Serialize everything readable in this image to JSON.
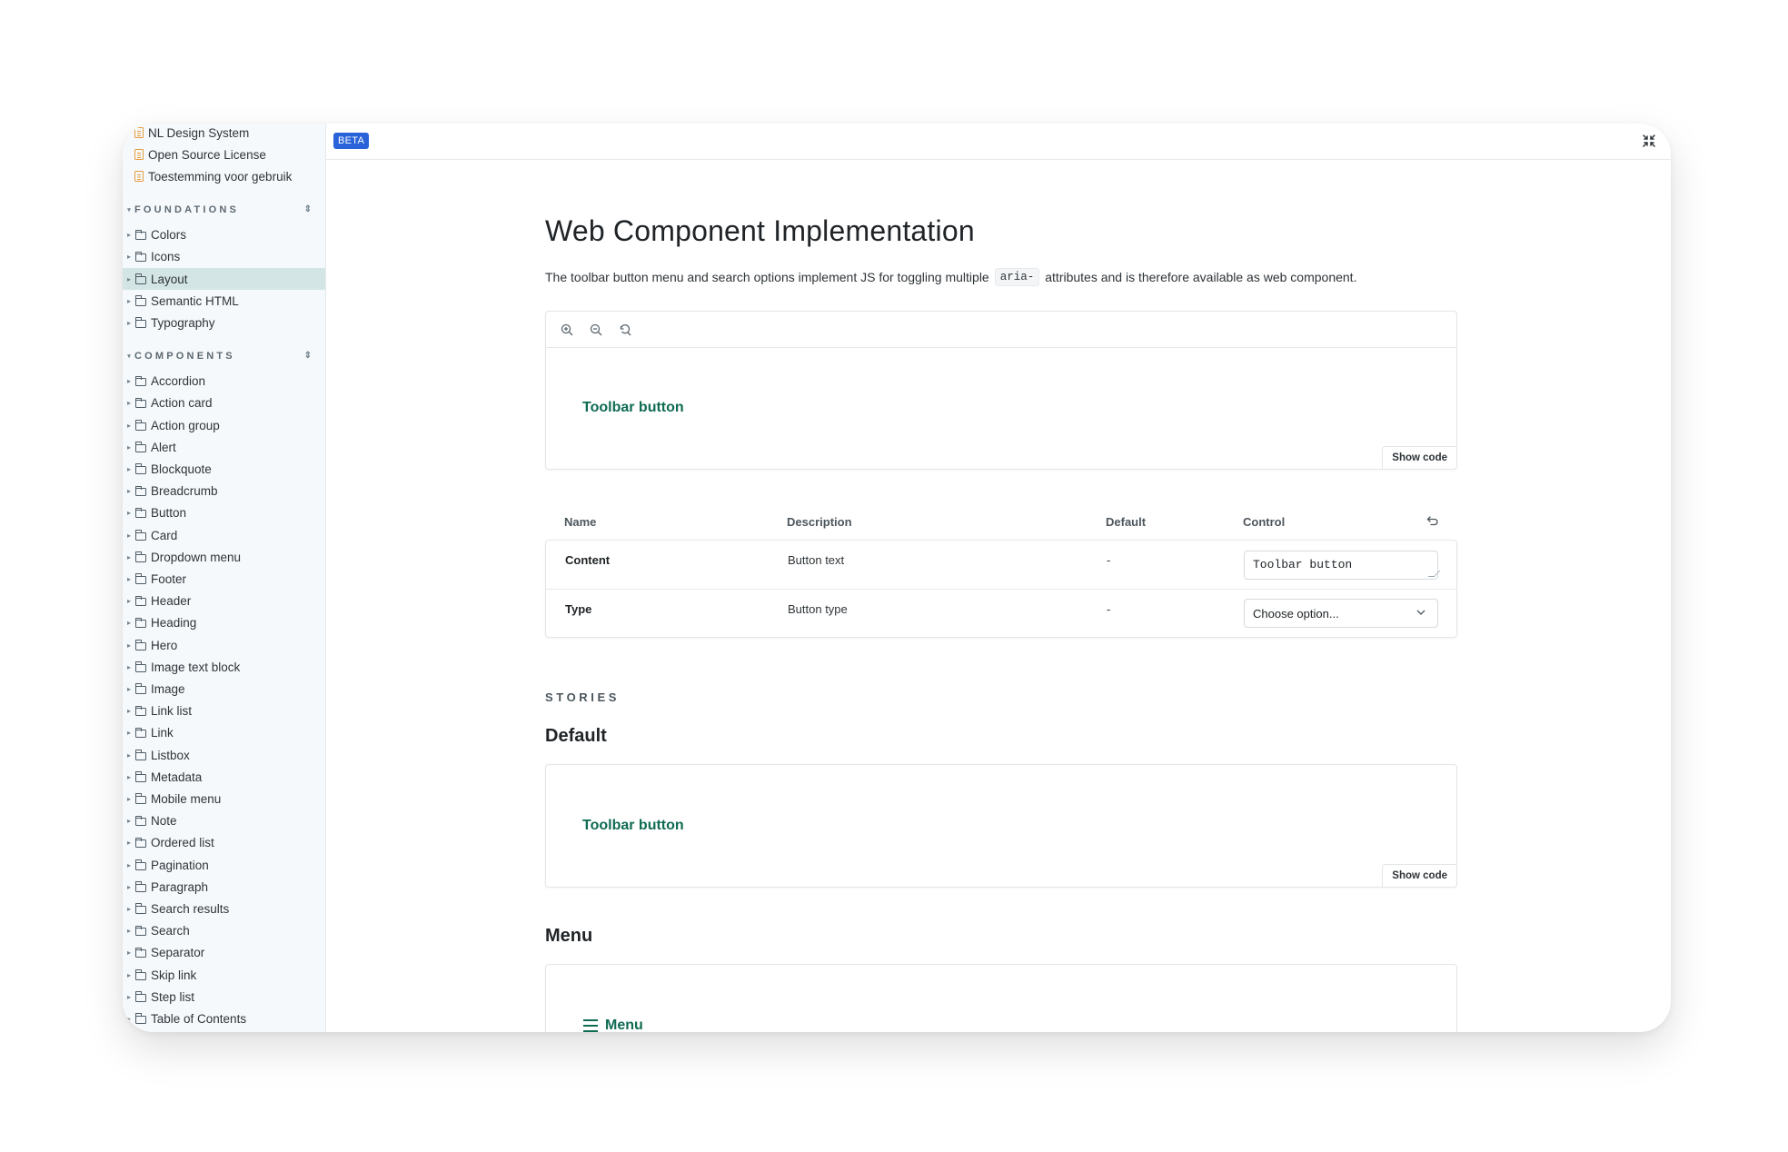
{
  "sidebar": {
    "docs": [
      {
        "label": "NL Design System"
      },
      {
        "label": "Open Source License"
      },
      {
        "label": "Toestemming voor gebruik"
      }
    ],
    "foundations_heading": "FOUNDATIONS",
    "foundations": [
      {
        "label": "Colors",
        "selected": false
      },
      {
        "label": "Icons",
        "selected": false
      },
      {
        "label": "Layout",
        "selected": true
      },
      {
        "label": "Semantic HTML",
        "selected": false
      },
      {
        "label": "Typography",
        "selected": false
      }
    ],
    "components_heading": "COMPONENTS",
    "components": [
      {
        "label": "Accordion"
      },
      {
        "label": "Action card"
      },
      {
        "label": "Action group"
      },
      {
        "label": "Alert"
      },
      {
        "label": "Blockquote"
      },
      {
        "label": "Breadcrumb"
      },
      {
        "label": "Button"
      },
      {
        "label": "Card"
      },
      {
        "label": "Dropdown menu"
      },
      {
        "label": "Footer"
      },
      {
        "label": "Header"
      },
      {
        "label": "Heading"
      },
      {
        "label": "Hero"
      },
      {
        "label": "Image text block"
      },
      {
        "label": "Image"
      },
      {
        "label": "Link list"
      },
      {
        "label": "Link"
      },
      {
        "label": "Listbox"
      },
      {
        "label": "Metadata"
      },
      {
        "label": "Mobile menu"
      },
      {
        "label": "Note"
      },
      {
        "label": "Ordered list"
      },
      {
        "label": "Pagination"
      },
      {
        "label": "Paragraph"
      },
      {
        "label": "Search results"
      },
      {
        "label": "Search"
      },
      {
        "label": "Separator"
      },
      {
        "label": "Skip link"
      },
      {
        "label": "Step list"
      },
      {
        "label": "Table of Contents"
      }
    ]
  },
  "topbar": {
    "badge": "BETA"
  },
  "page": {
    "title": "Web Component Implementation",
    "desc_before": "The toolbar button menu and search options implement JS for toggling multiple",
    "desc_code": "aria-",
    "desc_after": "attributes and is therefore available as web component."
  },
  "preview": {
    "button_label": "Toolbar button",
    "show_code": "Show code"
  },
  "args_table": {
    "headers": {
      "name": "Name",
      "description": "Description",
      "default": "Default",
      "control": "Control"
    },
    "rows": [
      {
        "name": "Content",
        "description": "Button text",
        "default": "-",
        "value": "Toolbar button"
      },
      {
        "name": "Type",
        "description": "Button type",
        "default": "-",
        "value": "Choose option..."
      }
    ]
  },
  "stories": {
    "label": "STORIES",
    "default_title": "Default",
    "default_button": "Toolbar button",
    "show_code": "Show code",
    "menu_title": "Menu",
    "menu_button": "Menu"
  },
  "colors": {
    "accent_green": "#0f6b52",
    "beta_blue": "#2a63d9",
    "selected_bg": "#d4e5e6"
  }
}
